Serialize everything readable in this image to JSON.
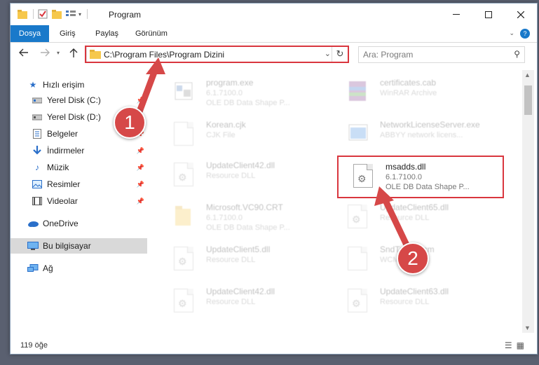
{
  "window": {
    "title": "Program",
    "accent_color": "#1979ca"
  },
  "ribbon": {
    "tabs": [
      "Dosya",
      "Giriş",
      "Paylaş",
      "Görünüm"
    ]
  },
  "navigation": {
    "address_path": "C:\\Program Files\\Program Dizini",
    "search_placeholder": "Ara: Program"
  },
  "sidebar": {
    "items": [
      {
        "label": "Hızlı erişim",
        "icon": "star-icon"
      },
      {
        "label": "Yerel Disk (C:)",
        "icon": "drive-icon"
      },
      {
        "label": "Yerel Disk (D:)",
        "icon": "drive-icon"
      },
      {
        "label": "Belgeler",
        "icon": "documents-icon"
      },
      {
        "label": "İndirmeler",
        "icon": "download-icon"
      },
      {
        "label": "Müzik",
        "icon": "music-icon"
      },
      {
        "label": "Resimler",
        "icon": "pictures-icon"
      },
      {
        "label": "Videolar",
        "icon": "videos-icon"
      },
      {
        "label": "OneDrive",
        "icon": "cloud-icon"
      },
      {
        "label": "Bu bilgisayar",
        "icon": "computer-icon"
      },
      {
        "label": "Ağ",
        "icon": "network-icon"
      }
    ]
  },
  "files": [
    {
      "name": "program.exe",
      "line1": "6.1.7100.0",
      "line2": "OLE DB Data Shape P..."
    },
    {
      "name": "certificates.cab",
      "line1": "WinRAR Archive",
      "line2": ""
    },
    {
      "name": "Korean.cjk",
      "line1": "CJK File",
      "line2": ""
    },
    {
      "name": "NetworkLicenseServer.exe",
      "line1": "ABBYY network licens...",
      "line2": ""
    },
    {
      "name": "UpdateClient42.dll",
      "line1": "Resource DLL",
      "line2": ""
    },
    {
      "name": "msadds.dll",
      "line1": "6.1.7100.0",
      "line2": "OLE DB Data Shape P..."
    },
    {
      "name": "Microsoft.VC90.CRT",
      "line1": "6.1.7100.0",
      "line2": "OLE DB Data Shape P..."
    },
    {
      "name": "UpdateClient65.dll",
      "line1": "Resource DLL",
      "line2": ""
    },
    {
      "name": "UpdateClient5.dll",
      "line1": "Resource DLL",
      "line2": ""
    },
    {
      "name": "SndTr...E.wcm",
      "line1": "WCM ...",
      "line2": ""
    },
    {
      "name": "UpdateClient42.dll",
      "line1": "Resource DLL",
      "line2": ""
    },
    {
      "name": "UpdateClient63.dll",
      "line1": "Resource DLL",
      "line2": ""
    }
  ],
  "status": {
    "item_count": "119 öğe"
  },
  "annotations": {
    "badge1": "1",
    "badge2": "2",
    "highlight_color": "#d9363e"
  }
}
